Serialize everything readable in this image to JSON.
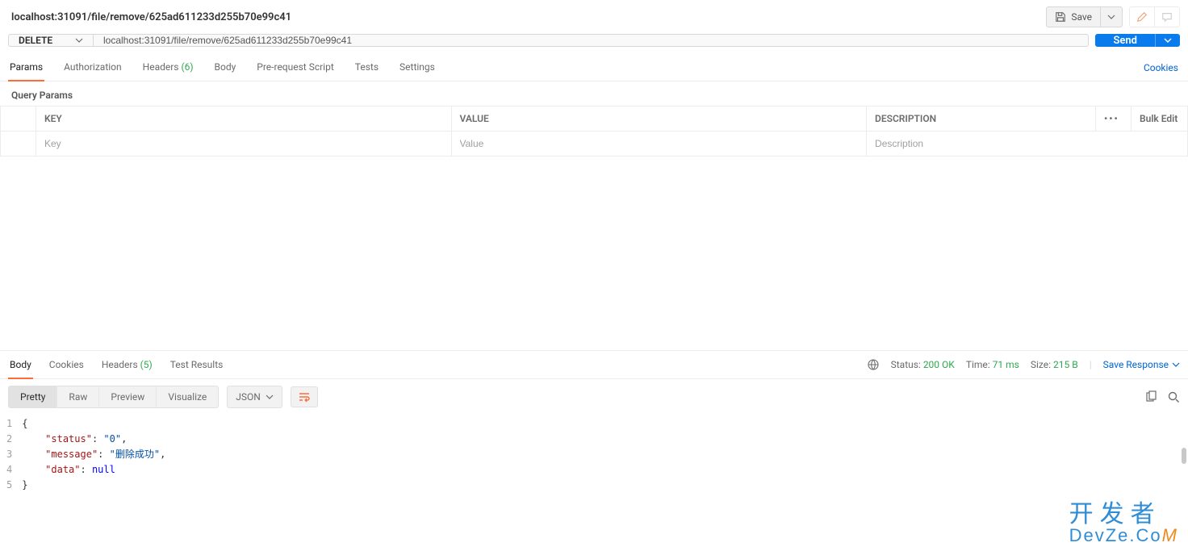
{
  "header": {
    "title": "localhost:31091/file/remove/625ad611233d255b70e99c41",
    "save_label": "Save"
  },
  "request": {
    "method": "DELETE",
    "url": "localhost:31091/file/remove/625ad611233d255b70e99c41",
    "send_label": "Send"
  },
  "req_tabs": {
    "params": "Params",
    "authorization": "Authorization",
    "headers_label": "Headers",
    "headers_count": "(6)",
    "body": "Body",
    "prerequest": "Pre-request Script",
    "tests": "Tests",
    "settings": "Settings",
    "cookies_link": "Cookies"
  },
  "params_section": {
    "title": "Query Params",
    "columns": {
      "key": "KEY",
      "value": "VALUE",
      "description": "DESCRIPTION",
      "bulk": "Bulk Edit"
    },
    "placeholders": {
      "key": "Key",
      "value": "Value",
      "description": "Description"
    }
  },
  "res_tabs": {
    "body": "Body",
    "cookies": "Cookies",
    "headers_label": "Headers",
    "headers_count": "(5)",
    "test_results": "Test Results"
  },
  "res_meta": {
    "status_label": "Status:",
    "status_value": "200 OK",
    "time_label": "Time:",
    "time_value": "71 ms",
    "size_label": "Size:",
    "size_value": "215 B",
    "save_response": "Save Response"
  },
  "body_toolbar": {
    "pretty": "Pretty",
    "raw": "Raw",
    "preview": "Preview",
    "visualize": "Visualize",
    "format": "JSON"
  },
  "response_body": {
    "lines": [
      "1",
      "2",
      "3",
      "4",
      "5"
    ],
    "json": {
      "status": "0",
      "message": "删除成功",
      "data": null
    }
  },
  "watermark": {
    "line1": "开发者",
    "line2_prefix": "DevZe.Co",
    "line2_M": "M"
  }
}
